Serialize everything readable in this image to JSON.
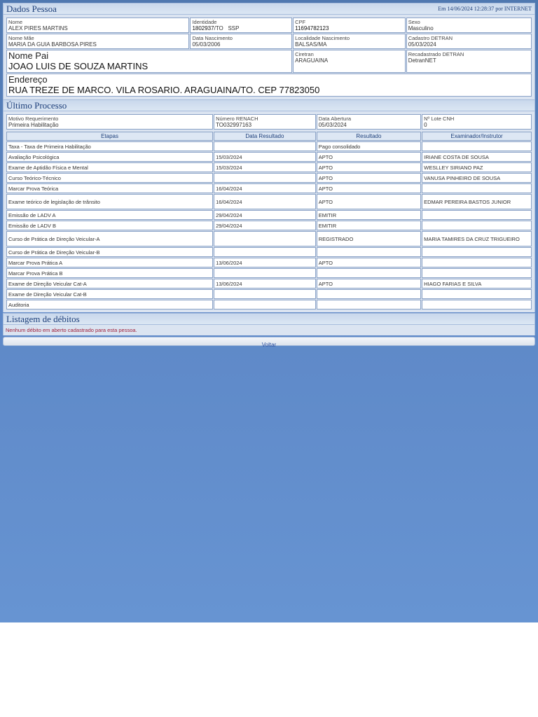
{
  "person": {
    "title": "Dados Pessoa",
    "timestamp": "Em 14/06/2024 12:28:37 por INTERNET",
    "nome_label": "Nome",
    "nome": "ALEX PIRES MARTINS",
    "identidade_label": "Identidade",
    "identidade_num": "1802937",
    "identidade_suffix": "/TO   SSP",
    "cpf_label": "CPF",
    "cpf": "11694782123",
    "sexo_label": "Sexo",
    "sexo": "Masculino",
    "mae_label": "Nome Mãe",
    "mae": "MARIA DA GUIA BARBOSA PIRES",
    "nascimento_label": "Data Nascimento",
    "nascimento": "05/03/2006",
    "localidade_label": "Localidade Nascimento",
    "localidade": "BALSAS/MA",
    "cadastro_label": "Cadastro DETRAN",
    "cadastro": "05/03/2024",
    "pai_label": "Nome Pai",
    "pai": "JOAO LUIS DE SOUZA MARTINS",
    "ciretran_label": "Ciretran",
    "ciretran": "ARAGUAINA",
    "recadastrado_label": "Recadastrado DETRAN",
    "recadastrado": "DetranNET",
    "endereco_label": "Endereço",
    "endereco": "RUA TREZE DE MARCO. VILA ROSARIO. ARAGUAINA/TO. CEP 77823050"
  },
  "process": {
    "title": "Último Processo",
    "motivo_label": "Motivo Requerimento",
    "motivo": "Primeira Habilitação",
    "renach_label": "Número RENACH",
    "renach": "TO032997163",
    "abertura_label": "Data Abertura",
    "abertura": "05/03/2024",
    "lote_label": "Nº Lote CNH",
    "lote": "0",
    "columns": [
      "Etapas",
      "Data Resultado",
      "Resultado",
      "Examinador/Instrutor"
    ],
    "rows": [
      {
        "etapa": "Taxa - Taxa de Primeira Habilitação",
        "data": "",
        "resultado": "Pago consolidado",
        "examinador": ""
      },
      {
        "etapa": "Avaliação Psicológica",
        "data": "15/03/2024",
        "resultado": "APTO",
        "examinador": "IRIANE COSTA DE SOUSA"
      },
      {
        "etapa": "Exame de Aptidão Física e Mental",
        "data": "15/03/2024",
        "resultado": "APTO",
        "examinador": "WESLLEY SIRIANO PAZ"
      },
      {
        "etapa": "Curso Teórico-Técnico",
        "data": "",
        "resultado": "APTO",
        "examinador": "VANUSA PINHEIRO DE SOUSA"
      },
      {
        "etapa": "Marcar Prova Teórica",
        "data": "16/04/2024",
        "resultado": "APTO",
        "examinador": ""
      },
      {
        "etapa": "Exame teórico de legislação de trânsito",
        "data": "16/04/2024",
        "resultado": "APTO",
        "examinador": "EDMAR PEREIRA BASTOS JUNIOR"
      },
      {
        "etapa": "Emissão de LADV A",
        "data": "29/04/2024",
        "resultado": "EMITIR",
        "examinador": ""
      },
      {
        "etapa": "Emissão de LADV B",
        "data": "29/04/2024",
        "resultado": "EMITIR",
        "examinador": ""
      },
      {
        "etapa": "Curso de Prática de Direção Veicular-A",
        "data": "",
        "resultado": "REGISTRADO",
        "examinador": "MARIA TAMIRES DA CRUZ TRIGUEIRO"
      },
      {
        "etapa": "Curso de Prática de Direção Veicular-B",
        "data": "",
        "resultado": "",
        "examinador": ""
      },
      {
        "etapa": "Marcar Prova Prática A",
        "data": "13/06/2024",
        "resultado": "APTO",
        "examinador": ""
      },
      {
        "etapa": "Marcar Prova Prática B",
        "data": "",
        "resultado": "",
        "examinador": ""
      },
      {
        "etapa": "Exame de Direção Veicular Cat-A",
        "data": "13/06/2024",
        "resultado": "APTO",
        "examinador": "HIAGO FARIAS E SILVA"
      },
      {
        "etapa": "Exame de Direção Veicular Cat-B",
        "data": "",
        "resultado": "",
        "examinador": ""
      },
      {
        "etapa": "Auditoria",
        "data": "",
        "resultado": "",
        "examinador": ""
      }
    ]
  },
  "debits": {
    "title": "Listagem de débitos",
    "message": "Nenhum débito em aberto cadastrado para esta pessoa."
  },
  "footer": {
    "back_label": "Voltar"
  },
  "colors": {
    "header_text": "#1d3f7a",
    "debit_text": "#a0203a",
    "background_gradient_top": "#4f78b0",
    "background_gradient_bottom": "#6794d2"
  }
}
